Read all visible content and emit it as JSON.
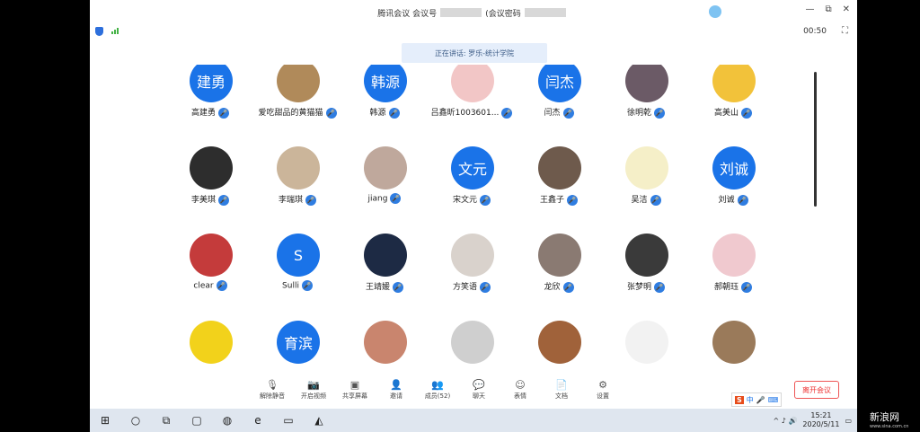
{
  "window": {
    "title_app": "腾讯会议",
    "title_meeting_id_label": "会议号",
    "title_password_label": "(会议密码",
    "minimize": "—",
    "restore": "⧉",
    "close": "✕"
  },
  "status": {
    "timer": "00:50",
    "fullscreen": "⛶"
  },
  "speaking": {
    "text": "正在讲话: 罗乐-统计学院"
  },
  "participants": [
    {
      "name": "高建勇",
      "avatar_text": "建勇",
      "avatar_color": "#1a73e8"
    },
    {
      "name": "爱吃甜品的黄猫猫",
      "avatar_text": "",
      "avatar_color": "#b08a5a"
    },
    {
      "name": "韩源",
      "avatar_text": "韩源",
      "avatar_color": "#1a73e8"
    },
    {
      "name": "吕鑫昕1003601...",
      "avatar_text": "",
      "avatar_color": "#f2c6c6"
    },
    {
      "name": "闫杰",
      "avatar_text": "闫杰",
      "avatar_color": "#1a73e8"
    },
    {
      "name": "徐明乾",
      "avatar_text": "",
      "avatar_color": "#6b5a66"
    },
    {
      "name": "高美山",
      "avatar_text": "",
      "avatar_color": "#f2c23a"
    },
    {
      "name": "李美琪",
      "avatar_text": "",
      "avatar_color": "#2d2d2d"
    },
    {
      "name": "李瑞琪",
      "avatar_text": "",
      "avatar_color": "#cbb59a"
    },
    {
      "name": "jiang",
      "avatar_text": "",
      "avatar_color": "#bfa89c"
    },
    {
      "name": "宋文元",
      "avatar_text": "文元",
      "avatar_color": "#1a73e8"
    },
    {
      "name": "王鑫子",
      "avatar_text": "",
      "avatar_color": "#6e5a4c"
    },
    {
      "name": "吴洁",
      "avatar_text": "",
      "avatar_color": "#f5efc8"
    },
    {
      "name": "刘诚",
      "avatar_text": "刘诚",
      "avatar_color": "#1a73e8"
    },
    {
      "name": "clear",
      "avatar_text": "",
      "avatar_color": "#c43b3b"
    },
    {
      "name": "Sulli",
      "avatar_text": "S",
      "avatar_color": "#1a73e8"
    },
    {
      "name": "王靖媛",
      "avatar_text": "",
      "avatar_color": "#1d2a44"
    },
    {
      "name": "方笑语",
      "avatar_text": "",
      "avatar_color": "#d9d2cc"
    },
    {
      "name": "龙欣",
      "avatar_text": "",
      "avatar_color": "#8a7a72"
    },
    {
      "name": "张梦明",
      "avatar_text": "",
      "avatar_color": "#3a3a3a"
    },
    {
      "name": "郝朝珏",
      "avatar_text": "",
      "avatar_color": "#f0c9cf"
    },
    {
      "name": "",
      "avatar_text": "",
      "avatar_color": "#f2d21b"
    },
    {
      "name": "",
      "avatar_text": "育滨",
      "avatar_color": "#1a73e8"
    },
    {
      "name": "",
      "avatar_text": "",
      "avatar_color": "#c9856e"
    },
    {
      "name": "",
      "avatar_text": "",
      "avatar_color": "#cfcfcf"
    },
    {
      "name": "",
      "avatar_text": "",
      "avatar_color": "#a0623a"
    },
    {
      "name": "",
      "avatar_text": "",
      "avatar_color": "#f2f2f2"
    },
    {
      "name": "",
      "avatar_text": "",
      "avatar_color": "#9a7a5a"
    }
  ],
  "toolbar": {
    "mute": "解除静音",
    "video": "开启视频",
    "share": "共享屏幕",
    "invite": "邀请",
    "members": "成员(52)",
    "chat": "聊天",
    "reactions": "表情",
    "docs": "文档",
    "settings": "设置",
    "leave": "离开会议"
  },
  "ime": {
    "logo": "S",
    "lang": "中"
  },
  "clock": {
    "time": "15:21",
    "date": "2020/5/11"
  },
  "watermark": {
    "brand": "新浪网",
    "url": "www.sina.com.cn"
  },
  "colors": {
    "accent": "#1a73e8",
    "mic": "#2f7de1",
    "leave": "#e33333"
  }
}
